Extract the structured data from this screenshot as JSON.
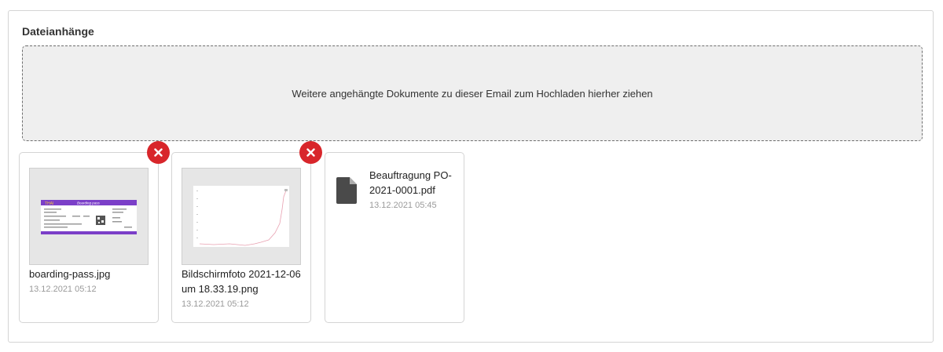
{
  "section": {
    "title": "Dateianhänge"
  },
  "dropzone": {
    "text": "Weitere angehängte Dokumente zu dieser Email zum Hochladen hierher ziehen"
  },
  "attachments": [
    {
      "name": "boarding-pass.jpg",
      "date": "13.12.2021 05:12",
      "thumbnail": "boarding-pass-image",
      "removable": true,
      "thumb_text": {
        "airline": "THAI",
        "header": "Boarding pass"
      }
    },
    {
      "name": "Bildschirmfoto 2021-12-06 um 18.33.19.png",
      "date": "13.12.2021 05:12",
      "thumbnail": "line-chart-screenshot",
      "removable": true
    },
    {
      "name": "Beauftragung PO-2021-0001.pdf",
      "date": "13.12.2021 05:45",
      "thumbnail": "file-icon",
      "removable": false
    }
  ],
  "colors": {
    "remove_button": "#d8262b",
    "dropzone_bg": "#efefef",
    "boarding_purple": "#7b3fc8",
    "chart_line": "#e8a0b0"
  }
}
